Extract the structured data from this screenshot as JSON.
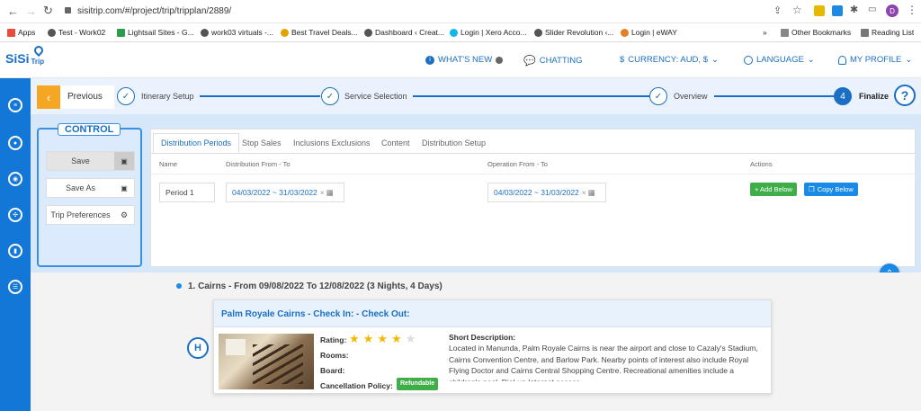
{
  "browser": {
    "url": "sisitrip.com/#/project/trip/tripplan/2889/",
    "profile_initial": "D",
    "bookmarks": [
      {
        "label": "Apps",
        "color": "#e74c3c"
      },
      {
        "label": "Test - Work02",
        "color": "#555"
      },
      {
        "label": "Lightsail Sites - G...",
        "color": "#2a9d4a"
      },
      {
        "label": "work03 virtuals -...",
        "color": "#555"
      },
      {
        "label": "Best Travel Deals...",
        "color": "#e6a100"
      },
      {
        "label": "Dashboard ‹ Creat...",
        "color": "#555"
      },
      {
        "label": "Login | Xero Acco...",
        "color": "#13b5ea"
      },
      {
        "label": "Slider Revolution ‹...",
        "color": "#555"
      },
      {
        "label": "Login | eWAY",
        "color": "#e67e22"
      }
    ],
    "more_label": "»",
    "other_bookmarks": "Other Bookmarks",
    "reading_list": "Reading List"
  },
  "app": {
    "logo_text": "SiSi",
    "logo_sub": "Trip",
    "nav": {
      "whats_new": "WHAT'S NEW",
      "chatting": "CHATTING",
      "currency": "CURRENCY: AUD, $",
      "language": "LANGUAGE",
      "profile": "MY PROFILE"
    }
  },
  "stepper": {
    "previous": "Previous",
    "steps": [
      {
        "label": "Itinerary Setup"
      },
      {
        "label": "Service Selection"
      },
      {
        "label": "Overview"
      },
      {
        "label": "Finalize",
        "number": "4"
      }
    ],
    "help": "?"
  },
  "control": {
    "title": "CONTROL",
    "save": "Save",
    "save_as": "Save As",
    "trip_preferences": "Trip Preferences"
  },
  "panel": {
    "tabs": [
      "Distribution Periods",
      "Stop Sales",
      "Inclusions Exclusions",
      "Content",
      "Distribution Setup"
    ],
    "headers": {
      "name": "Name",
      "distribution": "Distribution From - To",
      "operation": "Operation From - To",
      "actions": "Actions"
    },
    "row": {
      "name": "Period 1",
      "distribution": "04/03/2022 ~ 31/03/2022",
      "operation": "04/03/2022 ~ 31/03/2022",
      "add_below": "+ Add Below",
      "copy_below": "Copy Below"
    }
  },
  "itinerary": {
    "heading": "1. Cairns - From 09/08/2022 To 12/08/2022 (3 Nights, 4 Days)",
    "hotel": {
      "title": "Palm Royale Cairns - Check In: - Check Out:",
      "rating_label": "Rating:",
      "rating_value": 4,
      "rating_max": 5,
      "rooms_label": "Rooms:",
      "board_label": "Board:",
      "cancellation_label": "Cancellation Policy:",
      "cancellation_badge": "Refundable",
      "short_desc_label": "Short Description:",
      "short_desc": "Located in Manunda, Palm Royale Cairns is near the airport and close to Cazaly's Stadium, Cairns Convention Centre, and Barlow Park. Nearby points of interest also include Royal Flying Doctor and Cairns Central Shopping Centre. Recreational amenities include a children's pool. Dial-up Internet access"
    }
  },
  "colors": {
    "primary": "#1277d6",
    "accent_orange": "#f5a623",
    "green": "#3fae49",
    "link_blue": "#1a6fc4"
  }
}
